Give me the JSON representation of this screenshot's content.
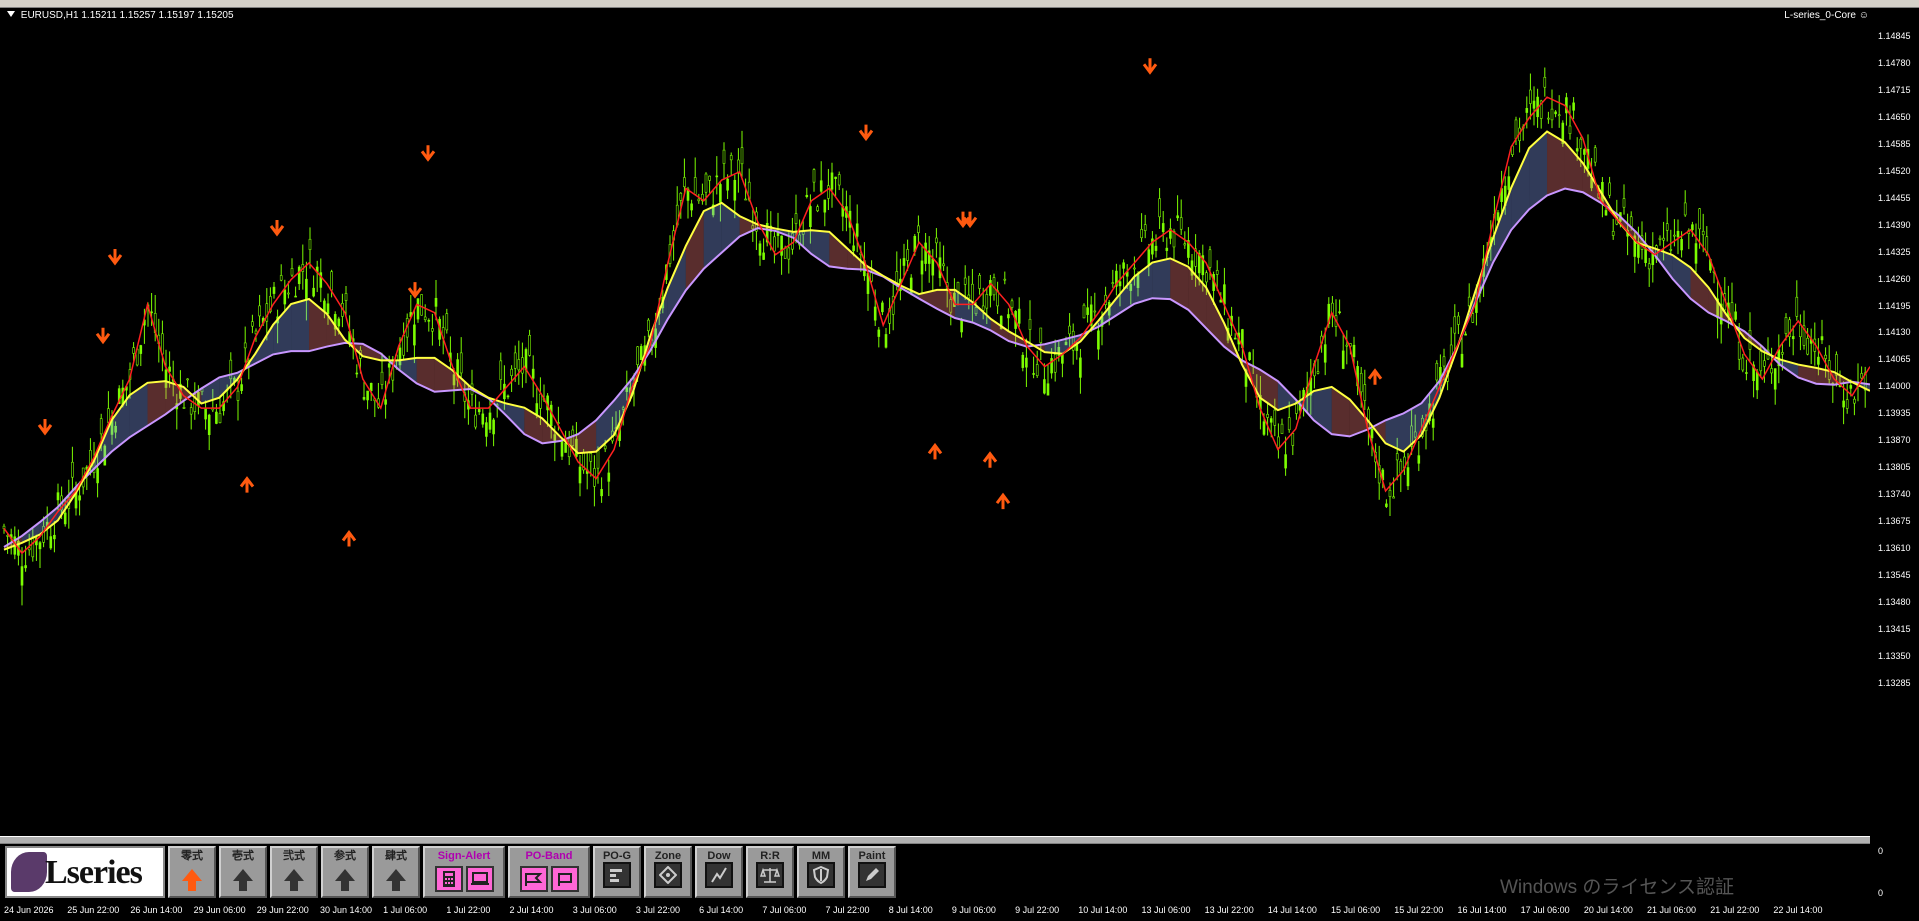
{
  "header": {
    "symbol": "EURUSD,H1",
    "ohlc": "1.15211 1.15257 1.15197 1.15205",
    "indicator_name": "L-series_0-Core"
  },
  "colors": {
    "candle": "#7CFC00",
    "ema_fast": "#ff2020",
    "ema_mid": "#ffff40",
    "ema_slow": "#c896ff",
    "ema_slow_down": "#ff80c0",
    "arrow": "#ff5a10",
    "fill_up": "#8da8ff",
    "fill_down": "#ff8080"
  },
  "price_axis": [
    "1.14845",
    "1.14780",
    "1.14715",
    "1.14650",
    "1.14585",
    "1.14520",
    "1.14455",
    "1.14390",
    "1.14325",
    "1.14260",
    "1.14195",
    "1.14130",
    "1.14065",
    "1.14000",
    "1.13935",
    "1.13870",
    "1.13805",
    "1.13740",
    "1.13675",
    "1.13610",
    "1.13545",
    "1.13480",
    "1.13415",
    "1.13350",
    "1.13285"
  ],
  "time_axis": [
    "24 Jun 2026",
    "25 Jun 22:00",
    "26 Jun 14:00",
    "29 Jun 06:00",
    "29 Jun 22:00",
    "30 Jun 14:00",
    "1 Jul 06:00",
    "1 Jul 22:00",
    "2 Jul 14:00",
    "3 Jul 06:00",
    "3 Jul 22:00",
    "6 Jul 14:00",
    "7 Jul 06:00",
    "7 Jul 22:00",
    "8 Jul 14:00",
    "9 Jul 06:00",
    "9 Jul 22:00",
    "10 Jul 14:00",
    "13 Jul 06:00",
    "13 Jul 22:00",
    "14 Jul 14:00",
    "15 Jul 06:00",
    "15 Jul 22:00",
    "16 Jul 14:00",
    "17 Jul 06:00",
    "20 Jul 14:00",
    "21 Jul 06:00",
    "21 Jul 22:00",
    "22 Jul 14:00"
  ],
  "subwindow_axis": {
    "top": "0",
    "bottom": "0"
  },
  "toolbar": {
    "logo_text": "Lseries",
    "buttons": [
      {
        "label": "零式",
        "icon": "up-arrow-orange"
      },
      {
        "label": "壱式",
        "icon": "up-arrow-dark"
      },
      {
        "label": "弐式",
        "icon": "up-arrow-dark"
      },
      {
        "label": "参式",
        "icon": "up-arrow-dark"
      },
      {
        "label": "肆式",
        "icon": "up-arrow-dark"
      }
    ],
    "sign_alert": "Sign-Alert",
    "po_band": "PO-Band",
    "tools": [
      {
        "label": "PO-G",
        "icon": "bars-icon"
      },
      {
        "label": "Zone",
        "icon": "diamond-icon"
      },
      {
        "label": "Dow",
        "icon": "zigzag-icon"
      },
      {
        "label": "R:R",
        "icon": "scale-icon"
      },
      {
        "label": "MM",
        "icon": "shield-icon"
      },
      {
        "label": "Paint",
        "icon": "pencil-icon"
      }
    ]
  },
  "watermark": {
    "line1": "Windows のライセンス認証"
  },
  "chart_data": {
    "type": "candlestick",
    "title": "",
    "ylim": [
      1.1325,
      1.1488
    ],
    "ema_fast": [
      1.1366,
      1.136,
      1.1364,
      1.137,
      1.1375,
      1.1383,
      1.1393,
      1.1402,
      1.142,
      1.1405,
      1.1398,
      1.1395,
      1.1395,
      1.14,
      1.1412,
      1.142,
      1.1426,
      1.143,
      1.1425,
      1.1418,
      1.1402,
      1.1395,
      1.141,
      1.142,
      1.1418,
      1.1405,
      1.1395,
      1.1395,
      1.14,
      1.1405,
      1.1398,
      1.139,
      1.1382,
      1.1378,
      1.1385,
      1.14,
      1.141,
      1.143,
      1.1448,
      1.1445,
      1.145,
      1.1452,
      1.144,
      1.1432,
      1.1435,
      1.1445,
      1.1448,
      1.1442,
      1.143,
      1.1415,
      1.1425,
      1.1435,
      1.143,
      1.142,
      1.142,
      1.1425,
      1.142,
      1.141,
      1.1405,
      1.1408,
      1.1412,
      1.1418,
      1.1425,
      1.143,
      1.1435,
      1.1438,
      1.1435,
      1.143,
      1.142,
      1.141,
      1.1395,
      1.1385,
      1.139,
      1.1405,
      1.1418,
      1.141,
      1.139,
      1.1375,
      1.138,
      1.139,
      1.14,
      1.141,
      1.142,
      1.144,
      1.1458,
      1.1465,
      1.147,
      1.1468,
      1.146,
      1.1445,
      1.144,
      1.1435,
      1.1432,
      1.1435,
      1.1438,
      1.1432,
      1.142,
      1.1408,
      1.1402,
      1.141,
      1.1416,
      1.141,
      1.1402,
      1.1398,
      1.1405
    ],
    "arrows_down": [
      [
        45,
        1.1389
      ],
      [
        103,
        1.1411
      ],
      [
        115,
        1.143
      ],
      [
        277,
        1.1437
      ],
      [
        415,
        1.1422
      ],
      [
        428,
        1.1455
      ],
      [
        866,
        1.146
      ],
      [
        963,
        1.1439
      ],
      [
        970,
        1.1439
      ],
      [
        1150,
        1.1476
      ]
    ],
    "arrows_up": [
      [
        247,
        1.1378
      ],
      [
        349,
        1.1365
      ],
      [
        935,
        1.1386
      ],
      [
        990,
        1.1384
      ],
      [
        1003,
        1.1374
      ],
      [
        1375,
        1.1404
      ]
    ]
  }
}
